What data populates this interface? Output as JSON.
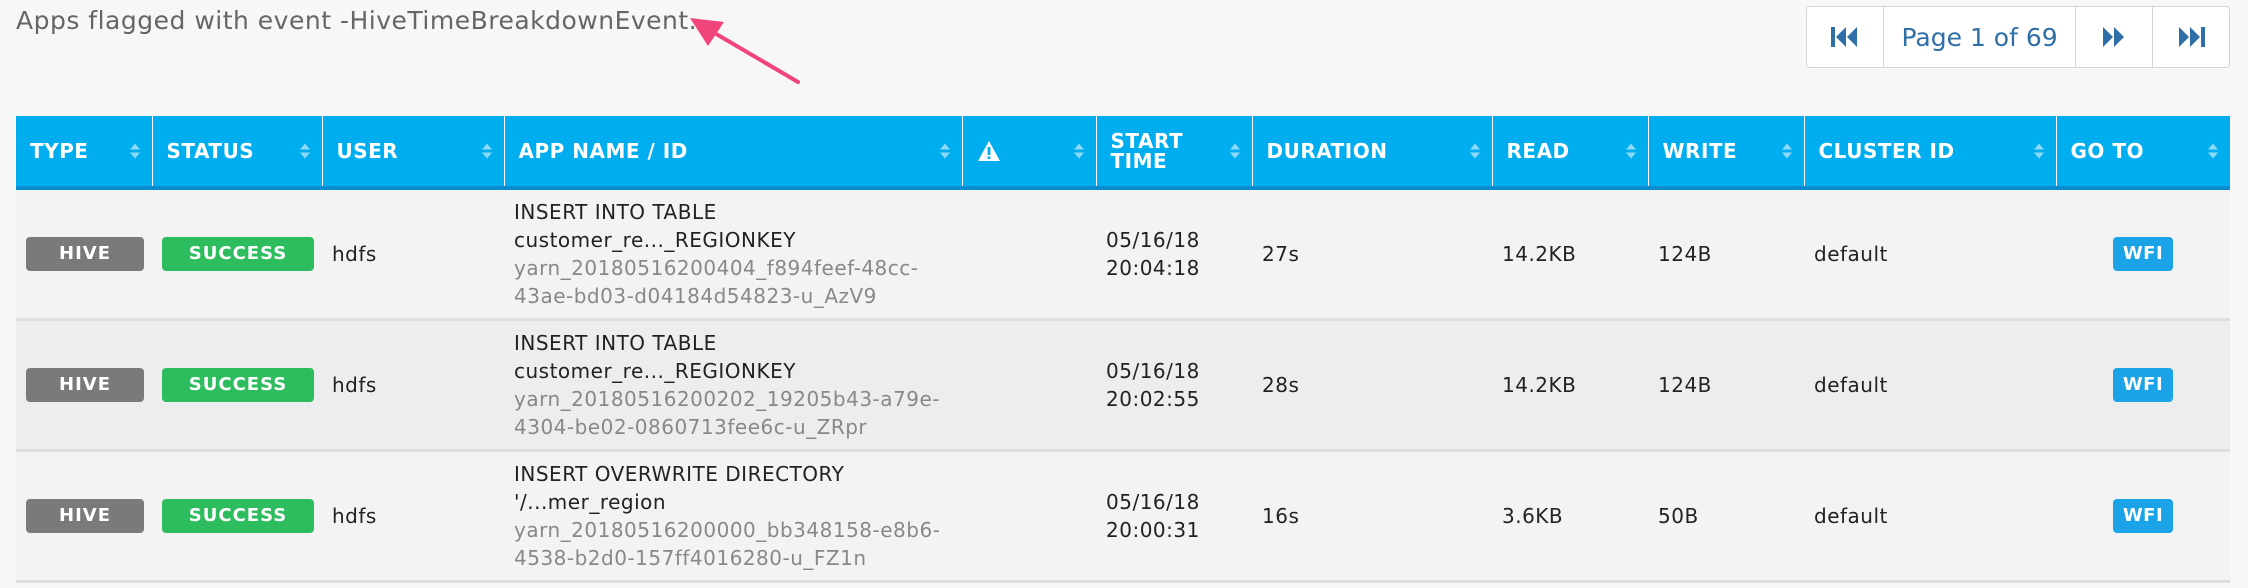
{
  "header": {
    "title": "Apps flagged with event -HiveTimeBreakdownEvent."
  },
  "pagination": {
    "label": "Page 1 of 69",
    "first_icon": "first-page-icon",
    "prev_icon": "prev-page-icon",
    "next_icon": "next-page-icon",
    "last_icon": "last-page-icon"
  },
  "table": {
    "columns": [
      {
        "label": "TYPE"
      },
      {
        "label": "STATUS"
      },
      {
        "label": "USER"
      },
      {
        "label": "APP NAME / ID"
      },
      {
        "label": "",
        "icon": "warning-icon"
      },
      {
        "label": "START TIME"
      },
      {
        "label": "DURATION"
      },
      {
        "label": "READ"
      },
      {
        "label": "WRITE"
      },
      {
        "label": "CLUSTER ID"
      },
      {
        "label": "GO TO"
      }
    ],
    "rows": [
      {
        "type": "HIVE",
        "status": "SUCCESS",
        "user": "hdfs",
        "name_line1": "INSERT INTO TABLE",
        "name_line2": "customer_re..._REGIONKEY",
        "id_line1": "yarn_20180516200404_f894feef-48cc-",
        "id_line2": "43ae-bd03-d04184d54823-u_AzV9",
        "start_date": "05/16/18",
        "start_time": "20:04:18",
        "duration": "27s",
        "read": "14.2KB",
        "write": "124B",
        "cluster": "default",
        "goto": "WFI"
      },
      {
        "type": "HIVE",
        "status": "SUCCESS",
        "user": "hdfs",
        "name_line1": "INSERT INTO TABLE",
        "name_line2": "customer_re..._REGIONKEY",
        "id_line1": "yarn_20180516200202_19205b43-a79e-",
        "id_line2": "4304-be02-0860713fee6c-u_ZRpr",
        "start_date": "05/16/18",
        "start_time": "20:02:55",
        "duration": "28s",
        "read": "14.2KB",
        "write": "124B",
        "cluster": "default",
        "goto": "WFI"
      },
      {
        "type": "HIVE",
        "status": "SUCCESS",
        "user": "hdfs",
        "name_line1": "INSERT OVERWRITE DIRECTORY",
        "name_line2": "'/...mer_region",
        "id_line1": "yarn_20180516200000_bb348158-e8b6-",
        "id_line2": "4538-b2d0-157ff4016280-u_FZ1n",
        "start_date": "05/16/18",
        "start_time": "20:00:31",
        "duration": "16s",
        "read": "3.6KB",
        "write": "50B",
        "cluster": "default",
        "goto": "WFI"
      }
    ]
  },
  "colors": {
    "header_bg": "#00aeef",
    "type_badge": "#7a7a7a",
    "success_badge": "#2ebd5e",
    "wfi_button": "#1ba3e8",
    "annotation_arrow": "#f0457a",
    "pager_text": "#2e6fa7"
  }
}
